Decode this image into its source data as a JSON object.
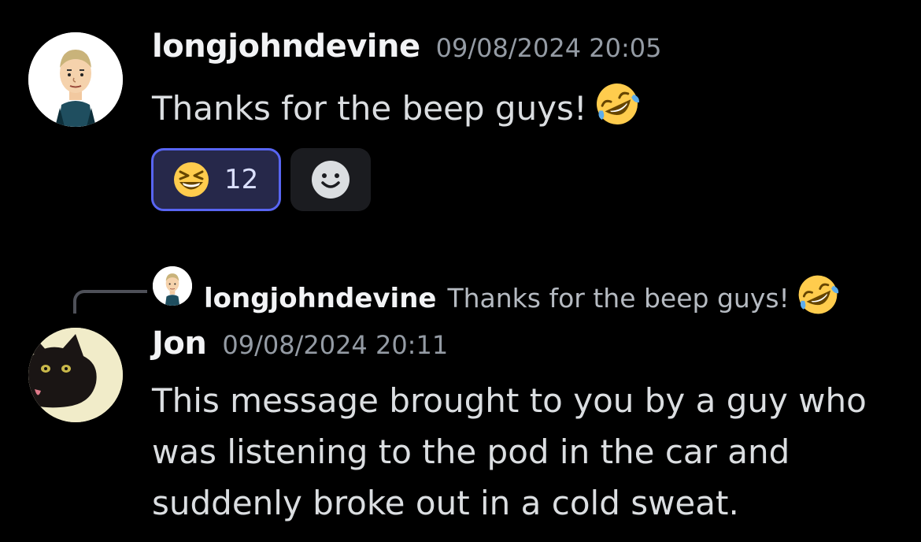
{
  "messages": [
    {
      "username": "longjohndevine",
      "timestamp": "09/08/2024 20:05",
      "text": "Thanks for the beep guys!",
      "trailing_emoji": "rolling-on-floor-laughing",
      "reactions": [
        {
          "emoji": "grinning-squinting-face",
          "count": "12",
          "active": true
        }
      ],
      "add_reaction_icon": "smiley-add-reaction"
    },
    {
      "reply_to": {
        "username": "longjohndevine",
        "text": "Thanks for the beep guys!",
        "trailing_emoji": "rolling-on-floor-laughing"
      },
      "username": "Jon",
      "timestamp": "09/08/2024 20:11",
      "lines": [
        "This message brought to you by a guy who",
        "was listening to the pod in the car and",
        "suddenly broke out in a cold sweat."
      ]
    }
  ],
  "colors": {
    "background": "#000000",
    "username": "#f2f3f5",
    "timestamp": "#949ba4",
    "message_text": "#dbdee1",
    "reaction_active_border": "#5865f2",
    "reaction_active_bg": "#26284a"
  }
}
